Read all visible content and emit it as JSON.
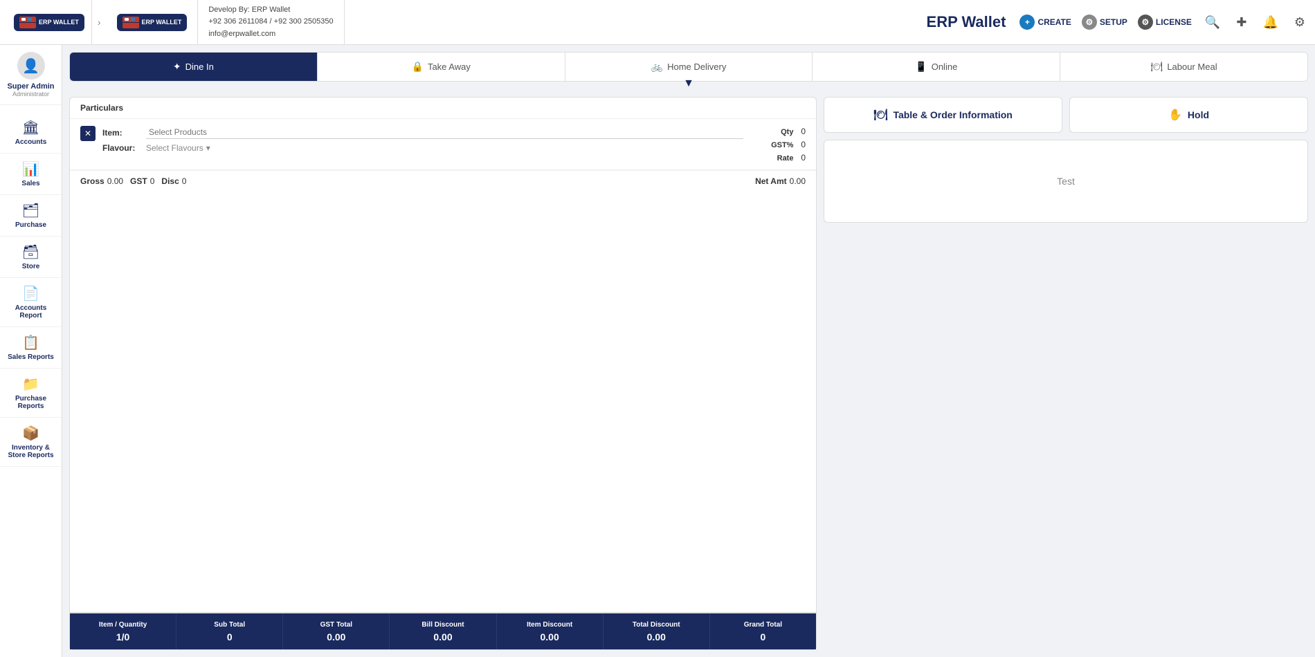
{
  "app": {
    "name": "ERP Wallet",
    "logo_text": "ERP WALLET"
  },
  "company": {
    "developer": "Develop By: ERP Wallet",
    "phone1": "+92 306 2611084",
    "phone2": "+92 300 2505350",
    "email": "info@erpwallet.com"
  },
  "header": {
    "brand": "ERP Wallet",
    "create_label": "CREATE",
    "setup_label": "SETUP",
    "license_label": "LICENSE"
  },
  "user": {
    "name": "Super Admin",
    "role": "Administrator"
  },
  "sidebar": {
    "items": [
      {
        "id": "accounts",
        "label": "Accounts",
        "icon": "🏛"
      },
      {
        "id": "sales",
        "label": "Sales",
        "icon": "📊"
      },
      {
        "id": "purchase",
        "label": "Purchase",
        "icon": "🗂"
      },
      {
        "id": "store",
        "label": "Store",
        "icon": "🗃"
      },
      {
        "id": "accounts-report",
        "label": "Accounts Report",
        "icon": "📄"
      },
      {
        "id": "sales-reports",
        "label": "Sales Reports",
        "icon": "📋"
      },
      {
        "id": "purchase-reports",
        "label": "Purchase Reports",
        "icon": "📁"
      },
      {
        "id": "inventory-store-reports",
        "label": "Inventory & Store Reports",
        "icon": "📦"
      }
    ]
  },
  "order_tabs": [
    {
      "id": "dine-in",
      "label": "Dine In",
      "icon": "✦",
      "active": true
    },
    {
      "id": "take-away",
      "label": "Take Away",
      "icon": "🔒"
    },
    {
      "id": "home-delivery",
      "label": "Home Delivery",
      "icon": "🚲"
    },
    {
      "id": "online",
      "label": "Online",
      "icon": "📱"
    },
    {
      "id": "labour-meal",
      "label": "Labour Meal",
      "icon": "🍽"
    }
  ],
  "particulars": {
    "header": "Particulars",
    "item_label": "Item:",
    "item_placeholder": "Select Products",
    "flavour_label": "Flavour:",
    "flavour_placeholder": "Select Flavours",
    "qty_label": "Qty",
    "qty_value": "0",
    "gst_label": "GST%",
    "gst_value": "0",
    "rate_label": "Rate",
    "rate_value": "0",
    "gross_label": "Gross",
    "gross_value": "0.00",
    "gst_total_label": "GST",
    "gst_total_value": "0",
    "disc_label": "Disc",
    "disc_value": "0",
    "net_amt_label": "Net Amt",
    "net_amt_value": "0.00"
  },
  "summary": {
    "items": [
      {
        "id": "item-quantity",
        "label": "Item / Quantity",
        "value": "1/0"
      },
      {
        "id": "sub-total",
        "label": "Sub Total",
        "value": "0"
      },
      {
        "id": "gst-total",
        "label": "GST Total",
        "value": "0.00"
      },
      {
        "id": "bill-discount",
        "label": "Bill Discount",
        "value": "0.00"
      },
      {
        "id": "item-discount",
        "label": "Item Discount",
        "value": "0.00"
      },
      {
        "id": "total-discount",
        "label": "Total Discount",
        "value": "0.00"
      },
      {
        "id": "grand-total",
        "label": "Grand Total",
        "value": "0"
      }
    ]
  },
  "right_panel": {
    "table_order_btn": "Table & Order Information",
    "hold_btn": "Hold",
    "test_label": "Test"
  }
}
